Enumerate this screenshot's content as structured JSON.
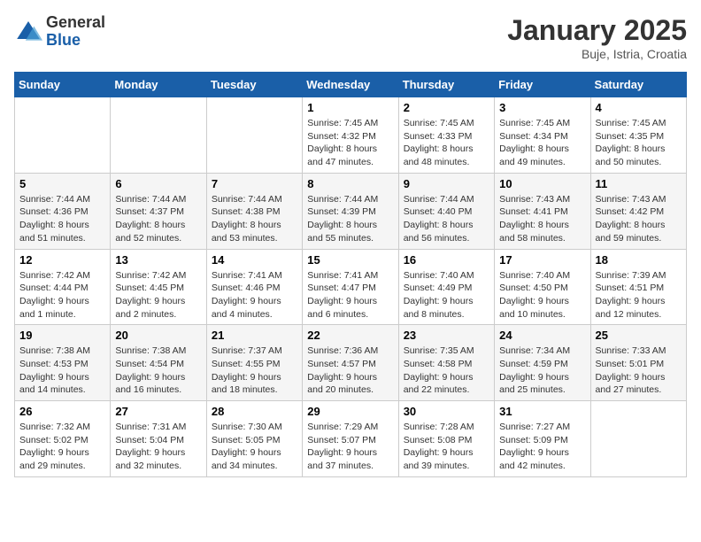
{
  "header": {
    "logo_general": "General",
    "logo_blue": "Blue",
    "month_title": "January 2025",
    "location": "Buje, Istria, Croatia"
  },
  "calendar": {
    "headers": [
      "Sunday",
      "Monday",
      "Tuesday",
      "Wednesday",
      "Thursday",
      "Friday",
      "Saturday"
    ],
    "weeks": [
      [
        {
          "day": "",
          "info": ""
        },
        {
          "day": "",
          "info": ""
        },
        {
          "day": "",
          "info": ""
        },
        {
          "day": "1",
          "info": "Sunrise: 7:45 AM\nSunset: 4:32 PM\nDaylight: 8 hours\nand 47 minutes."
        },
        {
          "day": "2",
          "info": "Sunrise: 7:45 AM\nSunset: 4:33 PM\nDaylight: 8 hours\nand 48 minutes."
        },
        {
          "day": "3",
          "info": "Sunrise: 7:45 AM\nSunset: 4:34 PM\nDaylight: 8 hours\nand 49 minutes."
        },
        {
          "day": "4",
          "info": "Sunrise: 7:45 AM\nSunset: 4:35 PM\nDaylight: 8 hours\nand 50 minutes."
        }
      ],
      [
        {
          "day": "5",
          "info": "Sunrise: 7:44 AM\nSunset: 4:36 PM\nDaylight: 8 hours\nand 51 minutes."
        },
        {
          "day": "6",
          "info": "Sunrise: 7:44 AM\nSunset: 4:37 PM\nDaylight: 8 hours\nand 52 minutes."
        },
        {
          "day": "7",
          "info": "Sunrise: 7:44 AM\nSunset: 4:38 PM\nDaylight: 8 hours\nand 53 minutes."
        },
        {
          "day": "8",
          "info": "Sunrise: 7:44 AM\nSunset: 4:39 PM\nDaylight: 8 hours\nand 55 minutes."
        },
        {
          "day": "9",
          "info": "Sunrise: 7:44 AM\nSunset: 4:40 PM\nDaylight: 8 hours\nand 56 minutes."
        },
        {
          "day": "10",
          "info": "Sunrise: 7:43 AM\nSunset: 4:41 PM\nDaylight: 8 hours\nand 58 minutes."
        },
        {
          "day": "11",
          "info": "Sunrise: 7:43 AM\nSunset: 4:42 PM\nDaylight: 8 hours\nand 59 minutes."
        }
      ],
      [
        {
          "day": "12",
          "info": "Sunrise: 7:42 AM\nSunset: 4:44 PM\nDaylight: 9 hours\nand 1 minute."
        },
        {
          "day": "13",
          "info": "Sunrise: 7:42 AM\nSunset: 4:45 PM\nDaylight: 9 hours\nand 2 minutes."
        },
        {
          "day": "14",
          "info": "Sunrise: 7:41 AM\nSunset: 4:46 PM\nDaylight: 9 hours\nand 4 minutes."
        },
        {
          "day": "15",
          "info": "Sunrise: 7:41 AM\nSunset: 4:47 PM\nDaylight: 9 hours\nand 6 minutes."
        },
        {
          "day": "16",
          "info": "Sunrise: 7:40 AM\nSunset: 4:49 PM\nDaylight: 9 hours\nand 8 minutes."
        },
        {
          "day": "17",
          "info": "Sunrise: 7:40 AM\nSunset: 4:50 PM\nDaylight: 9 hours\nand 10 minutes."
        },
        {
          "day": "18",
          "info": "Sunrise: 7:39 AM\nSunset: 4:51 PM\nDaylight: 9 hours\nand 12 minutes."
        }
      ],
      [
        {
          "day": "19",
          "info": "Sunrise: 7:38 AM\nSunset: 4:53 PM\nDaylight: 9 hours\nand 14 minutes."
        },
        {
          "day": "20",
          "info": "Sunrise: 7:38 AM\nSunset: 4:54 PM\nDaylight: 9 hours\nand 16 minutes."
        },
        {
          "day": "21",
          "info": "Sunrise: 7:37 AM\nSunset: 4:55 PM\nDaylight: 9 hours\nand 18 minutes."
        },
        {
          "day": "22",
          "info": "Sunrise: 7:36 AM\nSunset: 4:57 PM\nDaylight: 9 hours\nand 20 minutes."
        },
        {
          "day": "23",
          "info": "Sunrise: 7:35 AM\nSunset: 4:58 PM\nDaylight: 9 hours\nand 22 minutes."
        },
        {
          "day": "24",
          "info": "Sunrise: 7:34 AM\nSunset: 4:59 PM\nDaylight: 9 hours\nand 25 minutes."
        },
        {
          "day": "25",
          "info": "Sunrise: 7:33 AM\nSunset: 5:01 PM\nDaylight: 9 hours\nand 27 minutes."
        }
      ],
      [
        {
          "day": "26",
          "info": "Sunrise: 7:32 AM\nSunset: 5:02 PM\nDaylight: 9 hours\nand 29 minutes."
        },
        {
          "day": "27",
          "info": "Sunrise: 7:31 AM\nSunset: 5:04 PM\nDaylight: 9 hours\nand 32 minutes."
        },
        {
          "day": "28",
          "info": "Sunrise: 7:30 AM\nSunset: 5:05 PM\nDaylight: 9 hours\nand 34 minutes."
        },
        {
          "day": "29",
          "info": "Sunrise: 7:29 AM\nSunset: 5:07 PM\nDaylight: 9 hours\nand 37 minutes."
        },
        {
          "day": "30",
          "info": "Sunrise: 7:28 AM\nSunset: 5:08 PM\nDaylight: 9 hours\nand 39 minutes."
        },
        {
          "day": "31",
          "info": "Sunrise: 7:27 AM\nSunset: 5:09 PM\nDaylight: 9 hours\nand 42 minutes."
        },
        {
          "day": "",
          "info": ""
        }
      ]
    ]
  }
}
